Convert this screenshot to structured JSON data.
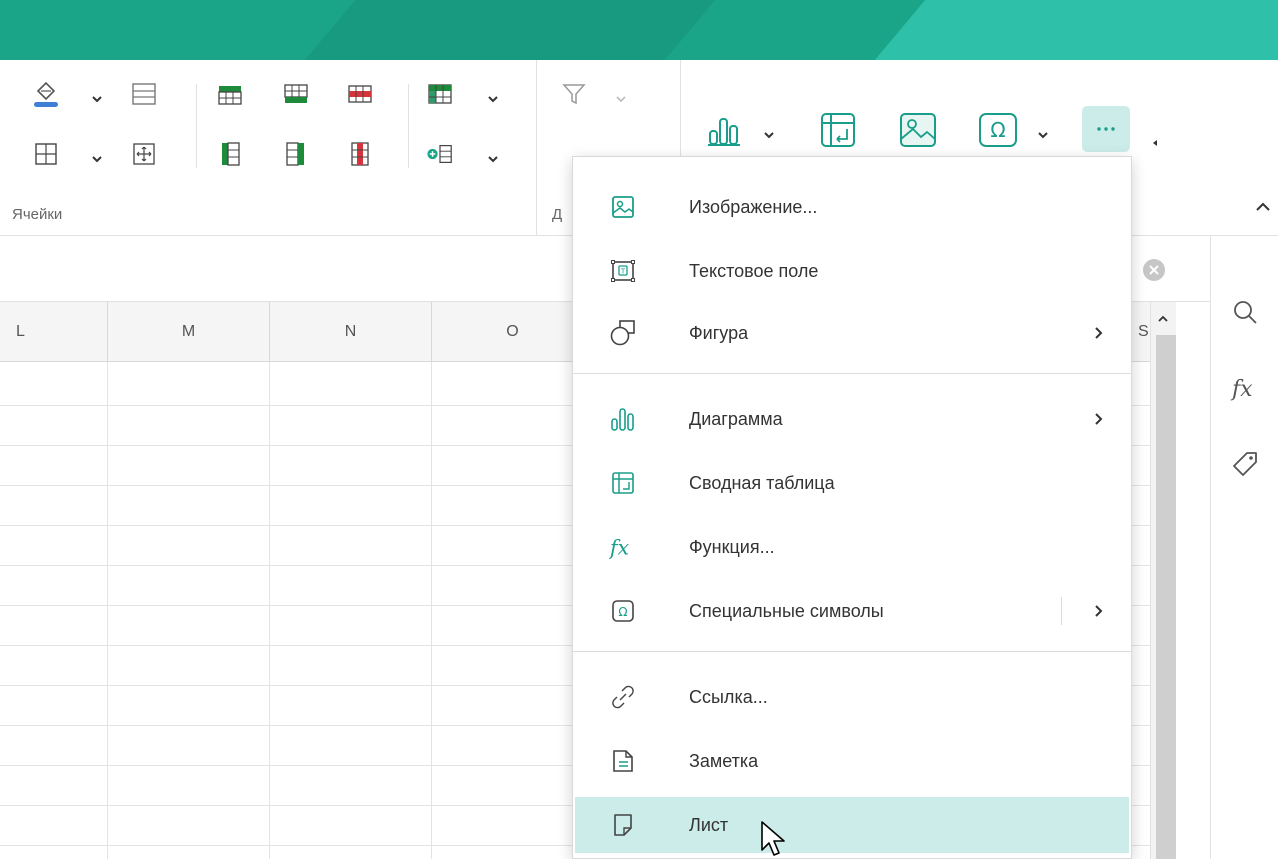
{
  "ribbon": {
    "cells_group_label": "Ячейки",
    "data_group_label": "Д"
  },
  "columns": [
    "L",
    "M",
    "N",
    "O",
    "S"
  ],
  "menu": {
    "items": [
      {
        "label": "Изображение...",
        "icon": "image-icon"
      },
      {
        "label": "Текстовое поле",
        "icon": "text-box-icon"
      },
      {
        "label": "Фигура",
        "icon": "shape-icon",
        "submenu": true
      },
      {
        "label": "Диаграмма",
        "icon": "chart-icon",
        "submenu": true
      },
      {
        "label": "Сводная таблица",
        "icon": "pivot-table-icon"
      },
      {
        "label": "Функция...",
        "icon": "function-icon"
      },
      {
        "label": "Специальные символы",
        "icon": "special-symbol-icon",
        "submenu": true
      },
      {
        "label": "Ссылка...",
        "icon": "link-icon"
      },
      {
        "label": "Заметка",
        "icon": "note-icon"
      },
      {
        "label": "Лист",
        "icon": "sheet-icon",
        "hovered": true
      }
    ]
  },
  "colors": {
    "accent": "#1aa589",
    "menu_hover": "#cbece9",
    "icon_teal": "#1a9d8a"
  }
}
